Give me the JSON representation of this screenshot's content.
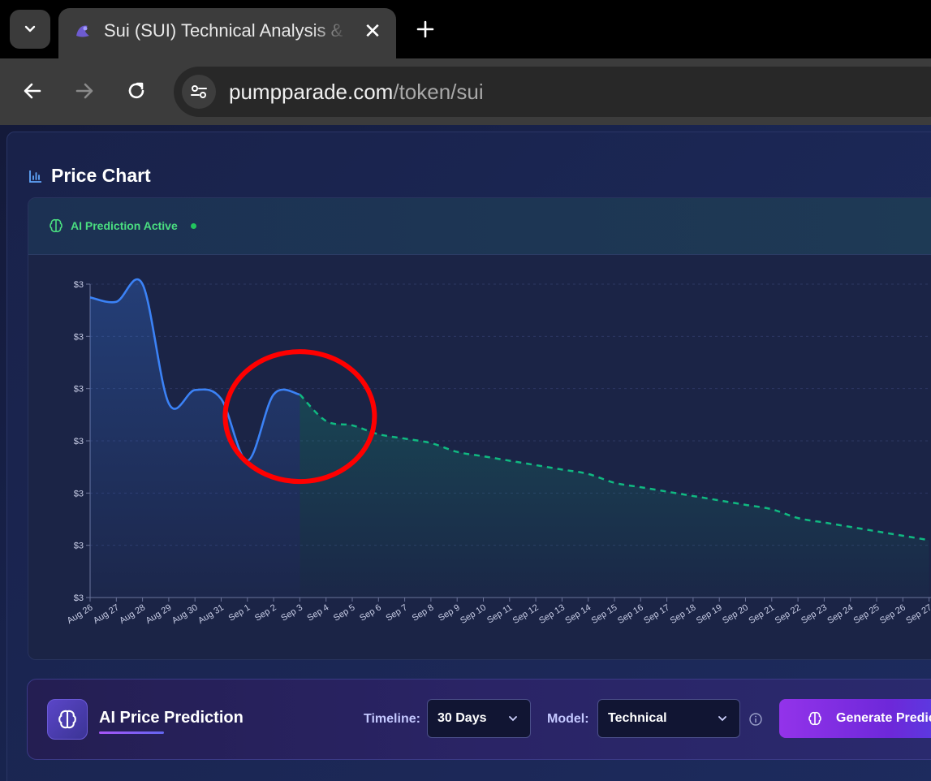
{
  "browser": {
    "tab_title": "Sui (SUI) Technical Analysis & Price Prediction",
    "url_host": "pumpparade.com",
    "url_path": "/token/sui"
  },
  "section": {
    "title": "Price Chart"
  },
  "chart_header": {
    "status": "AI Prediction Active"
  },
  "chart_data": {
    "type": "line",
    "ylabel": "",
    "xlabel": "",
    "y_tick_labels": [
      "$3",
      "$3",
      "$3",
      "$3",
      "$3",
      "$3",
      "$3"
    ],
    "categories": [
      "Aug 26",
      "Aug 27",
      "Aug 28",
      "Aug 29",
      "Aug 30",
      "Aug 31",
      "Sep 1",
      "Sep 2",
      "Sep 3",
      "Sep 4",
      "Sep 5",
      "Sep 6",
      "Sep 7",
      "Sep 8",
      "Sep 9",
      "Sep 10",
      "Sep 11",
      "Sep 12",
      "Sep 13",
      "Sep 14",
      "Sep 15",
      "Sep 16",
      "Sep 17",
      "Sep 18",
      "Sep 19",
      "Sep 20",
      "Sep 21",
      "Sep 22",
      "Sep 23",
      "Sep 24",
      "Sep 25",
      "Sep 26",
      "Sep 27"
    ],
    "series": [
      {
        "style": "solid",
        "color": "#3b82f6",
        "values": [
          3.45,
          3.44,
          3.48,
          3.21,
          3.24,
          3.22,
          3.08,
          3.23,
          3.23,
          null,
          null,
          null,
          null,
          null,
          null,
          null,
          null,
          null,
          null,
          null,
          null,
          null,
          null,
          null,
          null,
          null,
          null,
          null,
          null,
          null,
          null,
          null,
          null
        ]
      },
      {
        "style": "dashed",
        "color": "#10b981",
        "values": [
          null,
          null,
          null,
          null,
          null,
          null,
          null,
          null,
          3.23,
          3.17,
          3.16,
          3.14,
          3.13,
          3.12,
          3.1,
          3.09,
          3.08,
          3.07,
          3.06,
          3.05,
          3.03,
          3.02,
          3.01,
          3.0,
          2.99,
          2.98,
          2.97,
          2.95,
          2.94,
          2.93,
          2.92,
          2.91,
          2.9
        ]
      }
    ],
    "ylim": [
      2.77,
      3.48
    ],
    "grid": true,
    "annotation": "red-circle-highlight"
  },
  "prediction": {
    "title": "AI Price Prediction",
    "timeline_label": "Timeline:",
    "timeline_value": "30 Days",
    "model_label": "Model:",
    "model_value": "Technical",
    "generate_label": "Generate Prediction"
  },
  "colors": {
    "actual_line": "#3b82f6",
    "predicted_line": "#10b981",
    "highlight": "#ff0000"
  }
}
